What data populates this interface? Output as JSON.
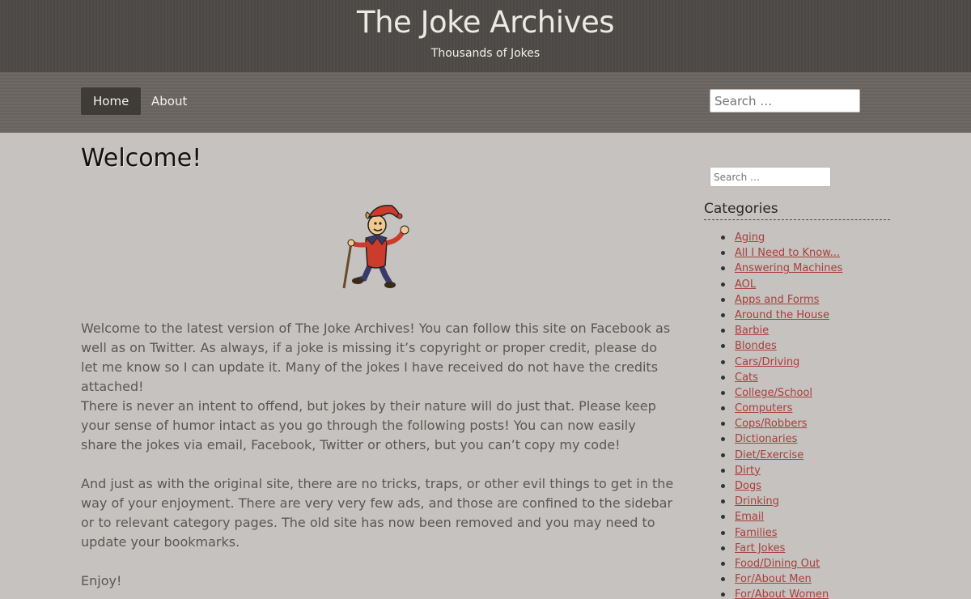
{
  "header": {
    "title": "The Joke Archives",
    "description": "Thousands of Jokes"
  },
  "nav": {
    "items": [
      {
        "label": "Home",
        "active": true
      },
      {
        "label": "About",
        "active": false
      }
    ],
    "search_placeholder": "Search …"
  },
  "main": {
    "title": "Welcome!",
    "paragraphs": [
      "Welcome to the latest version of The Joke Archives! You can follow this site on Facebook as well as on Twitter. As always, if a joke is missing it’s copyright or proper credit, please do let me know so I can update it. Many of the jokes I have received do not have the credits attached!",
      "There is never an intent to offend, but jokes by their nature will do just that. Please keep your sense of humor intact as you go through the following posts! You can now easily share the jokes via email, Facebook, Twitter or others, but you can’t copy my code!",
      "And just as with the original site, there are no tricks, traps, or other evil things to get in the way of your enjoyment. There are very very few ads, and those are confined to the sidebar or to relevant category pages. The old site has now been removed and you may need to update your bookmarks.",
      "Enjoy!"
    ]
  },
  "sidebar": {
    "search_placeholder": "Search …",
    "categories_title": "Categories",
    "categories": [
      "Aging",
      "All I Need to Know...",
      "Answering Machines",
      "AOL",
      "Apps and Forms",
      "Around the House",
      "Barbie",
      "Blondes",
      "Cars/Driving",
      "Cats",
      "College/School",
      "Computers",
      "Cops/Robbers",
      "Dictionaries",
      "Diet/Exercise",
      "Dirty",
      "Dogs",
      "Drinking",
      "Email",
      "Families",
      "Fart Jokes",
      "Food/Dining Out",
      "For/About Men",
      "For/About Women"
    ]
  },
  "colors": {
    "header_bg": "#4d4a47",
    "nav_bg": "#6b6661",
    "page_bg": "#c6c2bf",
    "link": "#a7403c"
  }
}
